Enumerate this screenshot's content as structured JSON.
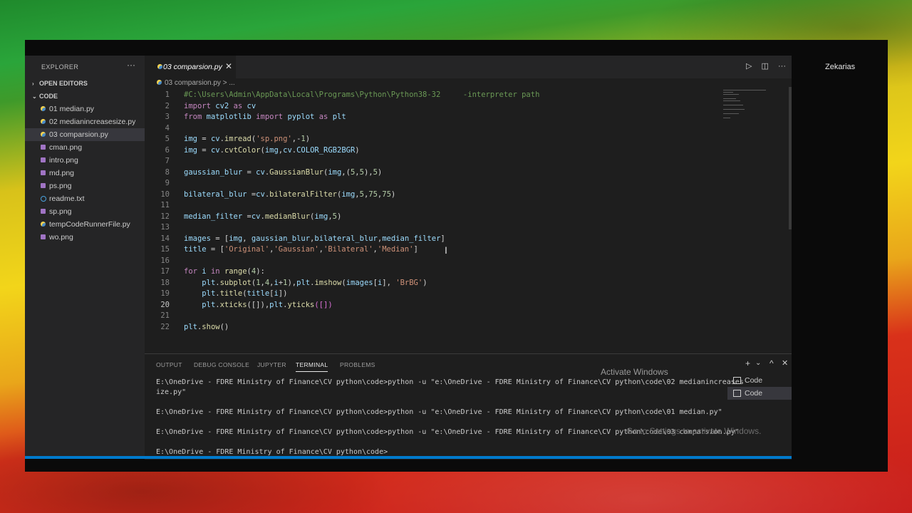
{
  "profile_name": "Zekarias",
  "sidebar": {
    "header": "EXPLORER",
    "more": "···",
    "open_editors": "OPEN EDITORS",
    "folder": "CODE",
    "files": [
      {
        "name": "01 median.py",
        "type": "py"
      },
      {
        "name": "02 medianincreasesize.py",
        "type": "py"
      },
      {
        "name": "03 comparsion.py",
        "type": "py"
      },
      {
        "name": "cman.png",
        "type": "png"
      },
      {
        "name": "intro.png",
        "type": "png"
      },
      {
        "name": "md.png",
        "type": "png"
      },
      {
        "name": "ps.png",
        "type": "png"
      },
      {
        "name": "readme.txt",
        "type": "txt"
      },
      {
        "name": "sp.png",
        "type": "png"
      },
      {
        "name": "tempCodeRunnerFile.py",
        "type": "py"
      },
      {
        "name": "wo.png",
        "type": "png"
      }
    ]
  },
  "editor": {
    "tab": "03 comparsion.py",
    "tab_close": "✕",
    "breadcrumb": "03 comparsion.py > ...",
    "actions": {
      "run": "▷",
      "split": "◫",
      "more": "···"
    },
    "line_numbers": [
      "1",
      "2",
      "3",
      "4",
      "5",
      "6",
      "7",
      "8",
      "9",
      "10",
      "11",
      "12",
      "13",
      "14",
      "15",
      "16",
      "17",
      "18",
      "19",
      "20",
      "21",
      "22"
    ]
  },
  "panel": {
    "tabs": [
      "OUTPUT",
      "DEBUG CONSOLE",
      "JUPYTER",
      "TERMINAL",
      "PROBLEMS"
    ],
    "active_tab": "TERMINAL",
    "controls": {
      "add": "+",
      "dropdown": "⌄",
      "maximize": "^",
      "close": "✕"
    },
    "terminal_lines": [
      "E:\\OneDrive - FDRE Ministry of Finance\\CV python\\code>python -u \"e:\\OneDrive - FDRE Ministry of Finance\\CV python\\code\\02 medianincreases",
      "ize.py\"",
      "E:\\OneDrive - FDRE Ministry of Finance\\CV python\\code>python -u \"e:\\OneDrive - FDRE Ministry of Finance\\CV python\\code\\01 median.py\"",
      "E:\\OneDrive - FDRE Ministry of Finance\\CV python\\code>python -u \"e:\\OneDrive - FDRE Ministry of Finance\\CV python\\code\\03 comparsion.py\"",
      "E:\\OneDrive - FDRE Ministry of Finance\\CV python\\code>"
    ],
    "terminal_list": [
      "Code",
      "Code"
    ]
  },
  "watermark": {
    "line1": "Activate Windows",
    "line2": "Go to Settings to activate Windows."
  }
}
